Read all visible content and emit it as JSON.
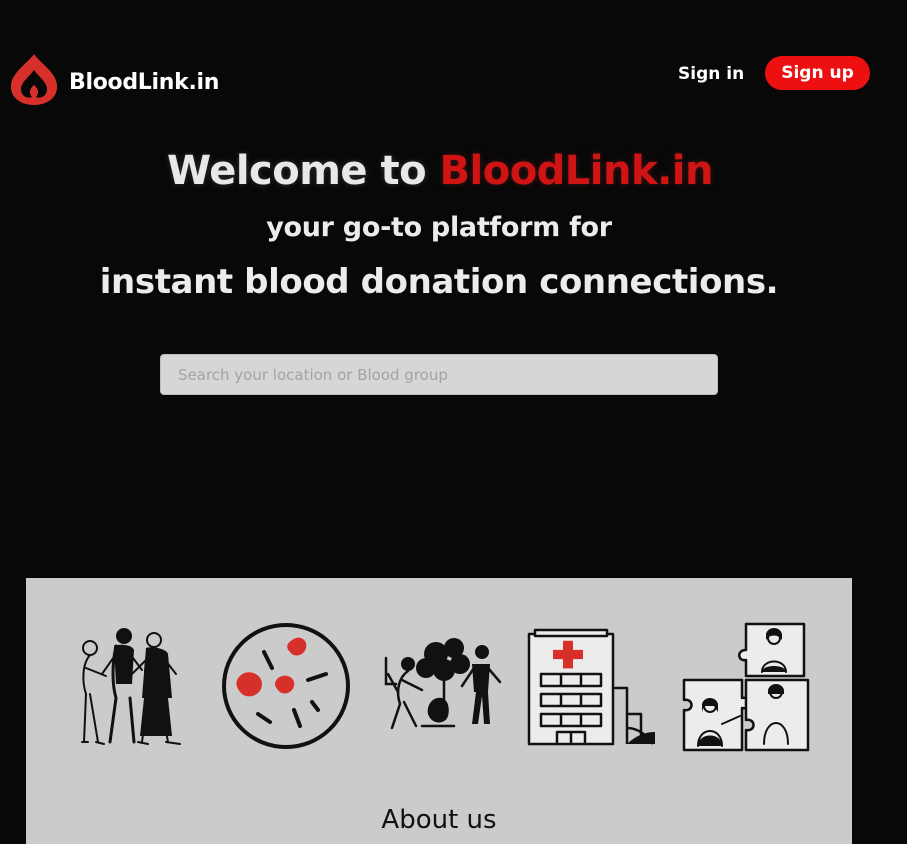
{
  "header": {
    "brand": "BloodLink.in",
    "signin_label": "Sign in",
    "signup_label": "Sign up"
  },
  "hero": {
    "welcome_prefix": "Welcome to ",
    "welcome_brand": "BloodLink.in",
    "tagline_1": "your go-to platform for",
    "tagline_2": "instant blood donation connections."
  },
  "search": {
    "placeholder": "Search your location or Blood group",
    "value": ""
  },
  "illustrations": [
    {
      "icon": "group-of-people-illustration"
    },
    {
      "icon": "blood-cells-petri-dish-illustration"
    },
    {
      "icon": "volunteers-planting-tree-illustration"
    },
    {
      "icon": "hospital-building-illustration"
    },
    {
      "icon": "puzzle-people-connection-illustration"
    }
  ],
  "about": {
    "title": "About us"
  },
  "colors": {
    "background": "#080808",
    "accent_red": "#d01414",
    "signup_red": "#ee1010",
    "panel": "#cbcbcb"
  }
}
